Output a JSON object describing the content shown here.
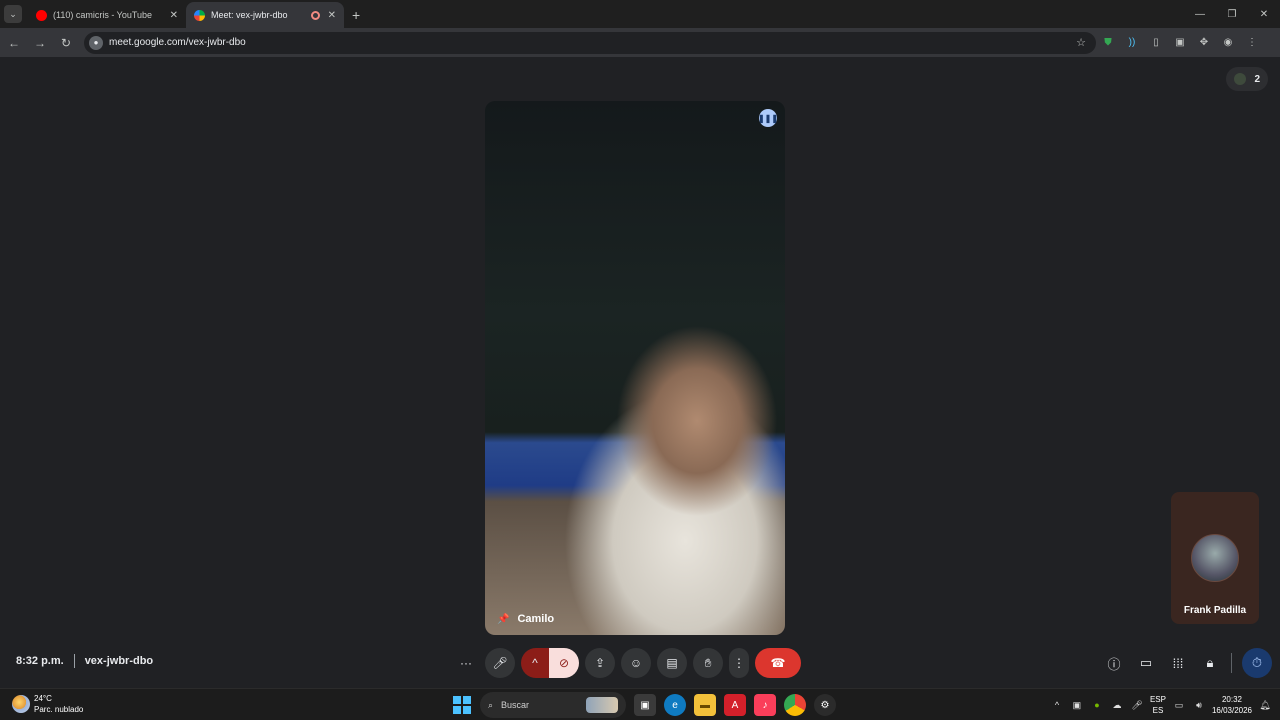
{
  "browser": {
    "tabs": [
      {
        "title": "(110) camicris - YouTube",
        "favicon_color": "#ff0000"
      },
      {
        "title": "Meet: vex-jwbr-dbo",
        "favicon_color": "#00ac47"
      }
    ],
    "new_tab": "+",
    "url": "meet.google.com/vex-jwbr-dbo",
    "window_controls": {
      "minimize": "—",
      "restore": "❐",
      "close": "✕"
    }
  },
  "meet": {
    "participant_count": "2",
    "main_tile": {
      "name": "Camilo"
    },
    "side_tile": {
      "name": "Frank Padilla"
    },
    "time": "8:32 p.m.",
    "meeting_code": "vex-jwbr-dbo",
    "colors": {
      "end_call": "#dc362e",
      "camera_off_bg": "#f9dedc",
      "speaking": "#aecbfa"
    }
  },
  "taskbar": {
    "weather": {
      "temp": "24°C",
      "desc": "Parc. nublado"
    },
    "search_placeholder": "Buscar",
    "language": {
      "top": "ESP",
      "bottom": "ES"
    },
    "clock": {
      "time": "20:32",
      "date": "16/03/2026"
    }
  }
}
